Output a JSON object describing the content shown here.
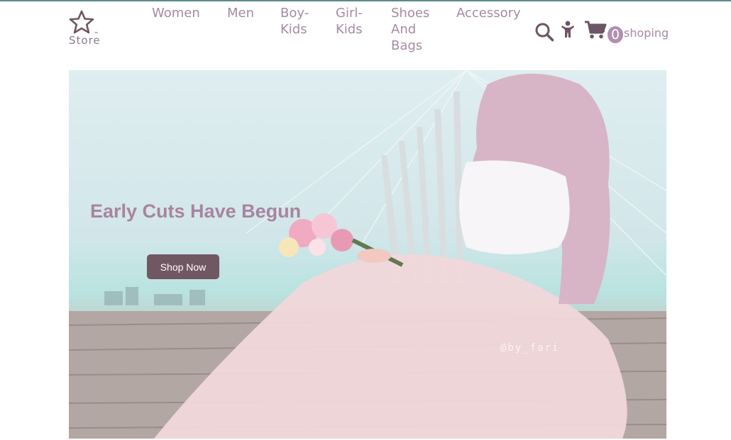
{
  "brand": {
    "dash": "-",
    "name": "Store",
    "icon": "star-icon"
  },
  "nav": [
    {
      "id": "women",
      "label": "Women"
    },
    {
      "id": "men",
      "label": "Men"
    },
    {
      "id": "boy-kids",
      "label": "Boy- Kids"
    },
    {
      "id": "girl-kids",
      "label": "Girl- Kids"
    },
    {
      "id": "shoes-bags",
      "label": "Shoes And Bags"
    },
    {
      "id": "accessory",
      "label": "Accessory"
    }
  ],
  "header_icons": {
    "search": "search-icon",
    "user": "person-icon",
    "cart": "cart-icon"
  },
  "cart": {
    "count": "0",
    "label": "shoping"
  },
  "hero": {
    "title": "Early Cuts Have Begun",
    "button": "Shop Now",
    "watermark": "@by_fari"
  },
  "colors": {
    "accent": "#a58aa2",
    "button": "#705762",
    "badge": "#b08fb0",
    "title": "#a8849f"
  }
}
